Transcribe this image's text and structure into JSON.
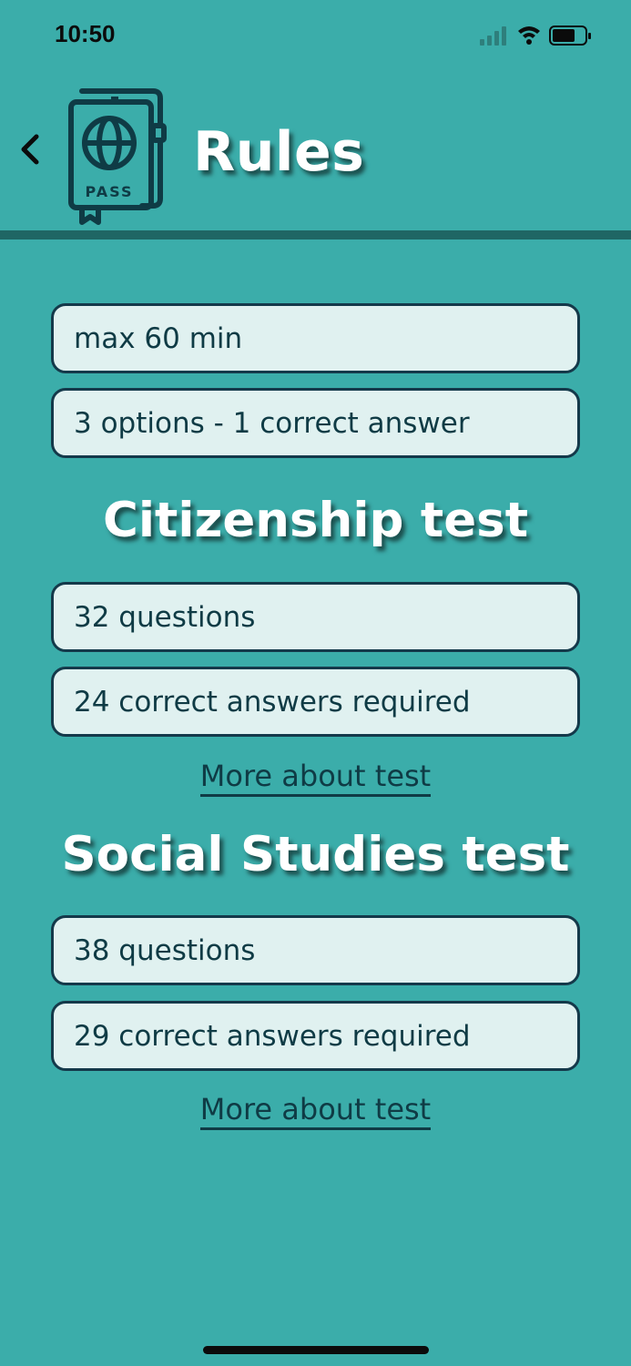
{
  "status_bar": {
    "time": "10:50",
    "icons": [
      "signal-icon",
      "wifi-icon",
      "battery-icon"
    ]
  },
  "header": {
    "title": "Rules",
    "logo_icon": "passport-icon",
    "logo_text": "PASS",
    "back_icon": "chevron-left-icon"
  },
  "general_rules": [
    "max 60 min",
    "3 options - 1 correct answer"
  ],
  "sections": [
    {
      "title": "Citizenship test",
      "rules": [
        "32 questions",
        "24 correct answers required"
      ],
      "link": "More about test"
    },
    {
      "title": "Social Studies test",
      "rules": [
        "38 questions",
        "29 correct answers required"
      ],
      "link": "More about test"
    }
  ],
  "colors": {
    "background": "#3badaa",
    "card": "#e0f1f0",
    "card_border": "#14394a",
    "text_dark": "#0f3b45",
    "divider": "#1f6664"
  }
}
